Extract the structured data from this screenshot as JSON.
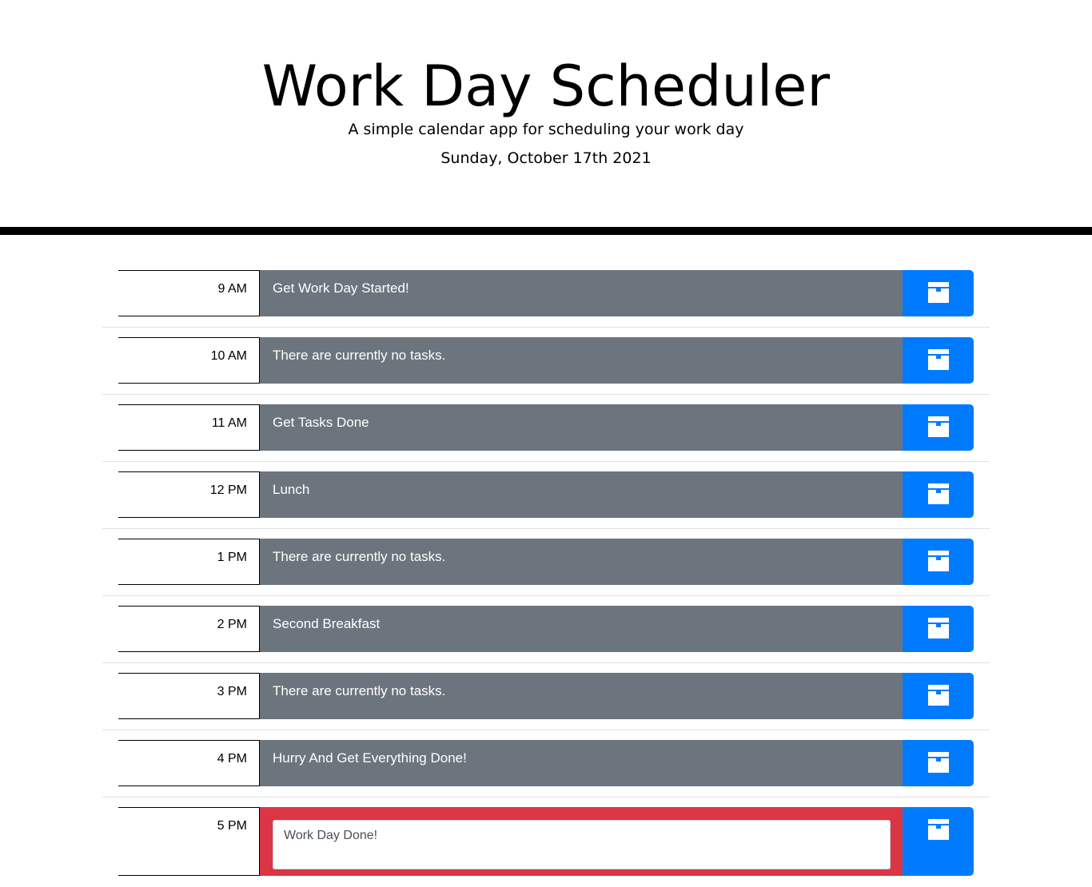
{
  "header": {
    "title": "Work Day Scheduler",
    "subtitle": "A simple calendar app for scheduling your work day",
    "current_day": "Sunday, October 17th 2021"
  },
  "colors": {
    "past": "#6c757d",
    "present": "#dc3545",
    "save_button": "#007bff"
  },
  "time_blocks": [
    {
      "hour": "9 AM",
      "task": "Get Work Day Started!",
      "state": "past"
    },
    {
      "hour": "10 AM",
      "task": "There are currently no tasks.",
      "state": "past"
    },
    {
      "hour": "11 AM",
      "task": "Get Tasks Done",
      "state": "past"
    },
    {
      "hour": "12 PM",
      "task": "Lunch",
      "state": "past"
    },
    {
      "hour": "1 PM",
      "task": "There are currently no tasks.",
      "state": "past"
    },
    {
      "hour": "2 PM",
      "task": "Second Breakfast",
      "state": "past"
    },
    {
      "hour": "3 PM",
      "task": "There are currently no tasks.",
      "state": "past"
    },
    {
      "hour": "4 PM",
      "task": "Hurry And Get Everything Done!",
      "state": "past"
    },
    {
      "hour": "5 PM",
      "task": "Work Day Done!",
      "state": "present"
    }
  ],
  "save_icon": "save-box-icon"
}
